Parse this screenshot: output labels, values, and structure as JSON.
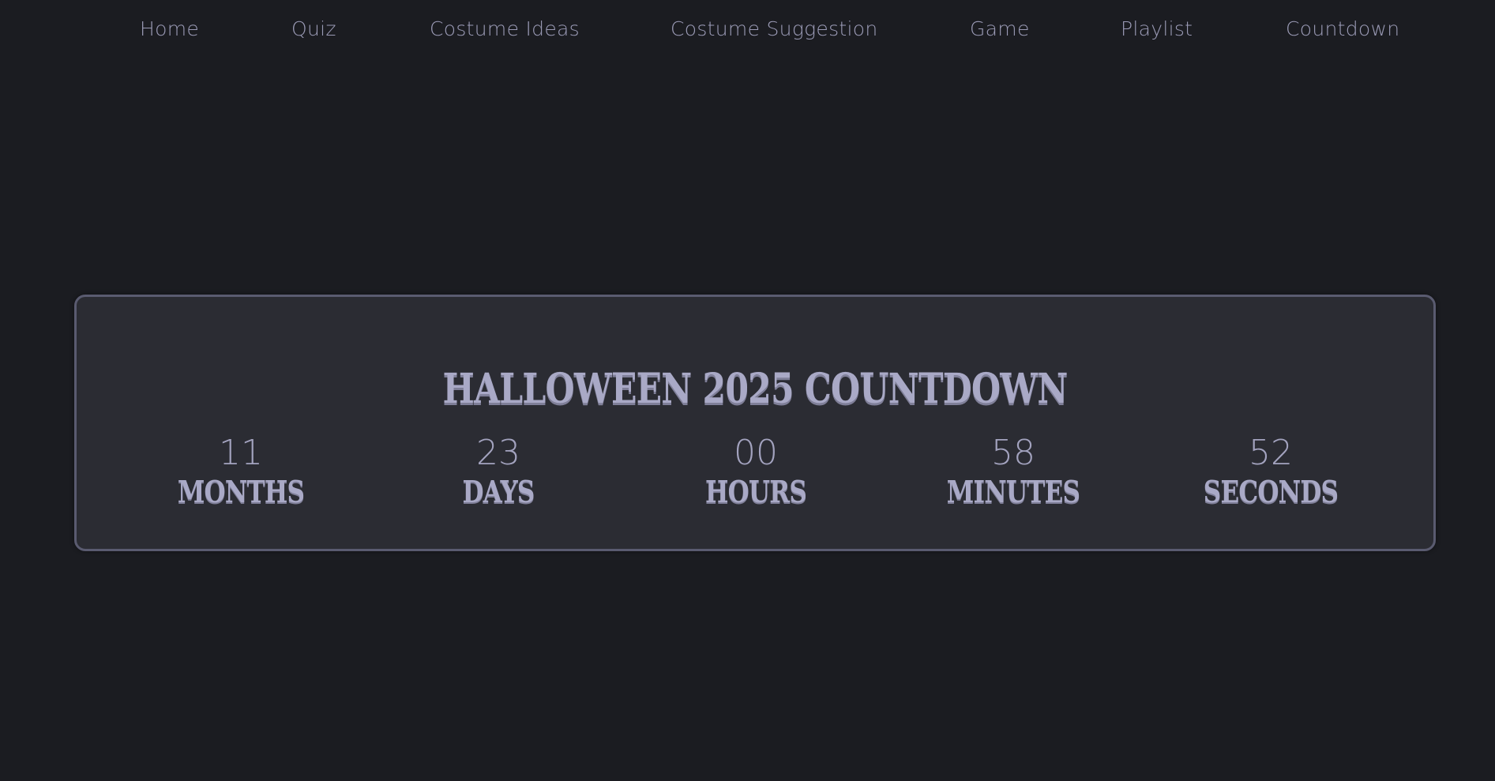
{
  "nav": {
    "items": [
      {
        "label": "Home"
      },
      {
        "label": "Quiz"
      },
      {
        "label": "Costume Ideas"
      },
      {
        "label": "Costume Suggestion"
      },
      {
        "label": "Game"
      },
      {
        "label": "Playlist"
      },
      {
        "label": "Countdown"
      }
    ]
  },
  "countdown": {
    "title": "Halloween 2025 Countdown",
    "units": [
      {
        "value": "11",
        "label": "Months"
      },
      {
        "value": "23",
        "label": "Days"
      },
      {
        "value": "00",
        "label": "Hours"
      },
      {
        "value": "58",
        "label": "Minutes"
      },
      {
        "value": "52",
        "label": "Seconds"
      }
    ]
  },
  "colors": {
    "background": "#1b1c21",
    "panel": "#2b2c33",
    "panel_border": "#5a5b70",
    "text": "#a9a9c6"
  }
}
